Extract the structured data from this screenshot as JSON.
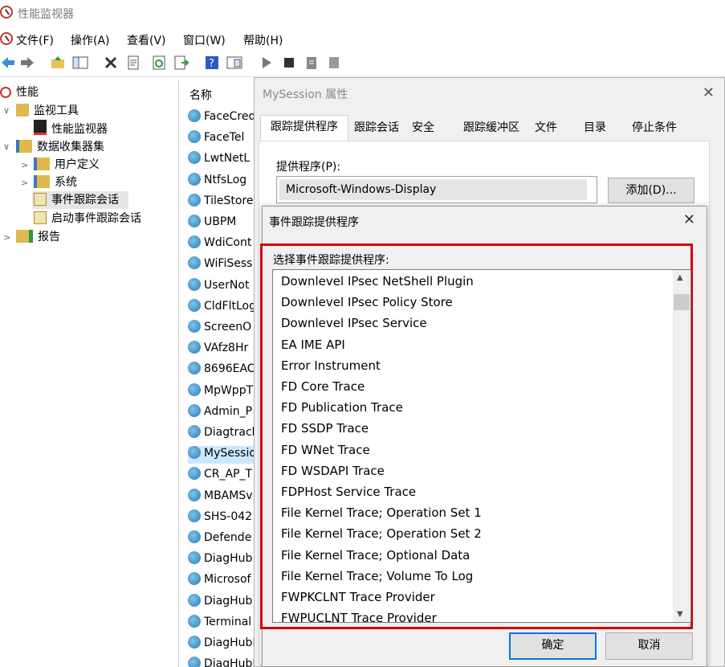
{
  "window": {
    "title": "性能监视器"
  },
  "menu": [
    "文件(F)",
    "操作(A)",
    "查看(V)",
    "窗口(W)",
    "帮助(H)"
  ],
  "tree": {
    "items": [
      {
        "label": "性能",
        "icon": "performance-icon"
      },
      {
        "label": "监视工具",
        "icon": "folder-icon"
      },
      {
        "label": "性能监视器",
        "icon": "monitor-chart-icon"
      },
      {
        "label": "数据收集器集",
        "icon": "data-collector-icon"
      },
      {
        "label": "用户定义",
        "icon": "user-folder-icon"
      },
      {
        "label": "系统",
        "icon": "system-folder-icon"
      },
      {
        "label": "事件跟踪会话",
        "icon": "trace-session-icon"
      },
      {
        "label": "启动事件跟踪会话",
        "icon": "startup-trace-icon"
      },
      {
        "label": "报告",
        "icon": "report-icon"
      }
    ]
  },
  "list": {
    "header": "名称",
    "rows": [
      "FaceCred",
      "FaceTel",
      "LwtNetL",
      "NtfsLog",
      "TileStore",
      "UBPM",
      "WdiCont",
      "WiFiSess",
      "UserNot",
      "CldFltLog",
      "ScreenO",
      "VAfz8Hr",
      "8696EAC",
      "MpWppT",
      "Admin_P",
      "Diagtrack",
      "MySessio",
      "CR_AP_T",
      "MBAMSv",
      "SHS-042",
      "Defende",
      "DiagHub",
      "Microsof",
      "DiagHub",
      "Terminal",
      "DiagHubE",
      "DiagHubE"
    ],
    "selected": "MySessio"
  },
  "props_dialog": {
    "title": "MySession 属性",
    "tabs": [
      "跟踪提供程序",
      "跟踪会话",
      "安全",
      "跟踪缓冲区",
      "文件",
      "目录",
      "停止条件"
    ],
    "provider_label": "提供程序(P):",
    "provider_value": "Microsoft-Windows-Display",
    "add_button": "添加(D)..."
  },
  "picker_dialog": {
    "title": "事件跟踪提供程序",
    "label": "选择事件跟踪提供程序:",
    "providers": [
      "Downlevel IPsec NetShell Plugin",
      "Downlevel IPsec Policy Store",
      "Downlevel IPsec Service",
      "EA IME API",
      "Error Instrument",
      "FD Core Trace",
      "FD Publication Trace",
      "FD SSDP Trace",
      "FD WNet Trace",
      "FD WSDAPI Trace",
      "FDPHost Service Trace",
      "File Kernel Trace; Operation Set 1",
      "File Kernel Trace; Operation Set 2",
      "File Kernel Trace; Optional Data",
      "File Kernel Trace; Volume To Log",
      "FWPKCLNT Trace Provider",
      "FWPUCLNT Trace Provider"
    ],
    "ok": "确定",
    "cancel": "取消"
  },
  "colors": {
    "highlight": "#d40000",
    "selection": "#cce8ff",
    "accent": "#0078d7"
  }
}
